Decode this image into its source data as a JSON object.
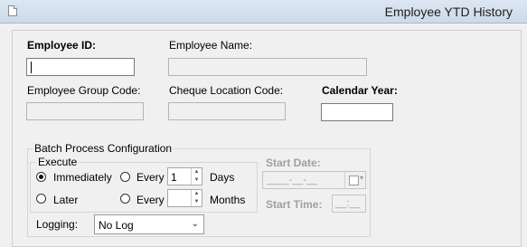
{
  "window": {
    "title": "Employee YTD History"
  },
  "form": {
    "employee_id_label": "Employee ID:",
    "employee_id_value": "",
    "employee_name_label": "Employee Name:",
    "employee_name_value": "",
    "employee_group_label": "Employee Group Code:",
    "employee_group_value": "",
    "cheque_location_label": "Cheque Location Code:",
    "cheque_location_value": "",
    "calendar_year_label": "Calendar Year:",
    "calendar_year_value": ""
  },
  "batch": {
    "group_title": "Batch Process Configuration",
    "execute_title": "Execute",
    "immediately_label": "Immediately",
    "later_label": "Later",
    "every_days_label": "Every",
    "every_days_value": "1",
    "days_label": "Days",
    "every_months_label": "Every",
    "every_months_value": "",
    "months_label": "Months",
    "start_date_label": "Start Date:",
    "start_date_value": "____-__-__",
    "start_time_label": "Start Time:",
    "start_time_value": "__:__",
    "logging_label": "Logging:",
    "logging_value": "No Log"
  }
}
